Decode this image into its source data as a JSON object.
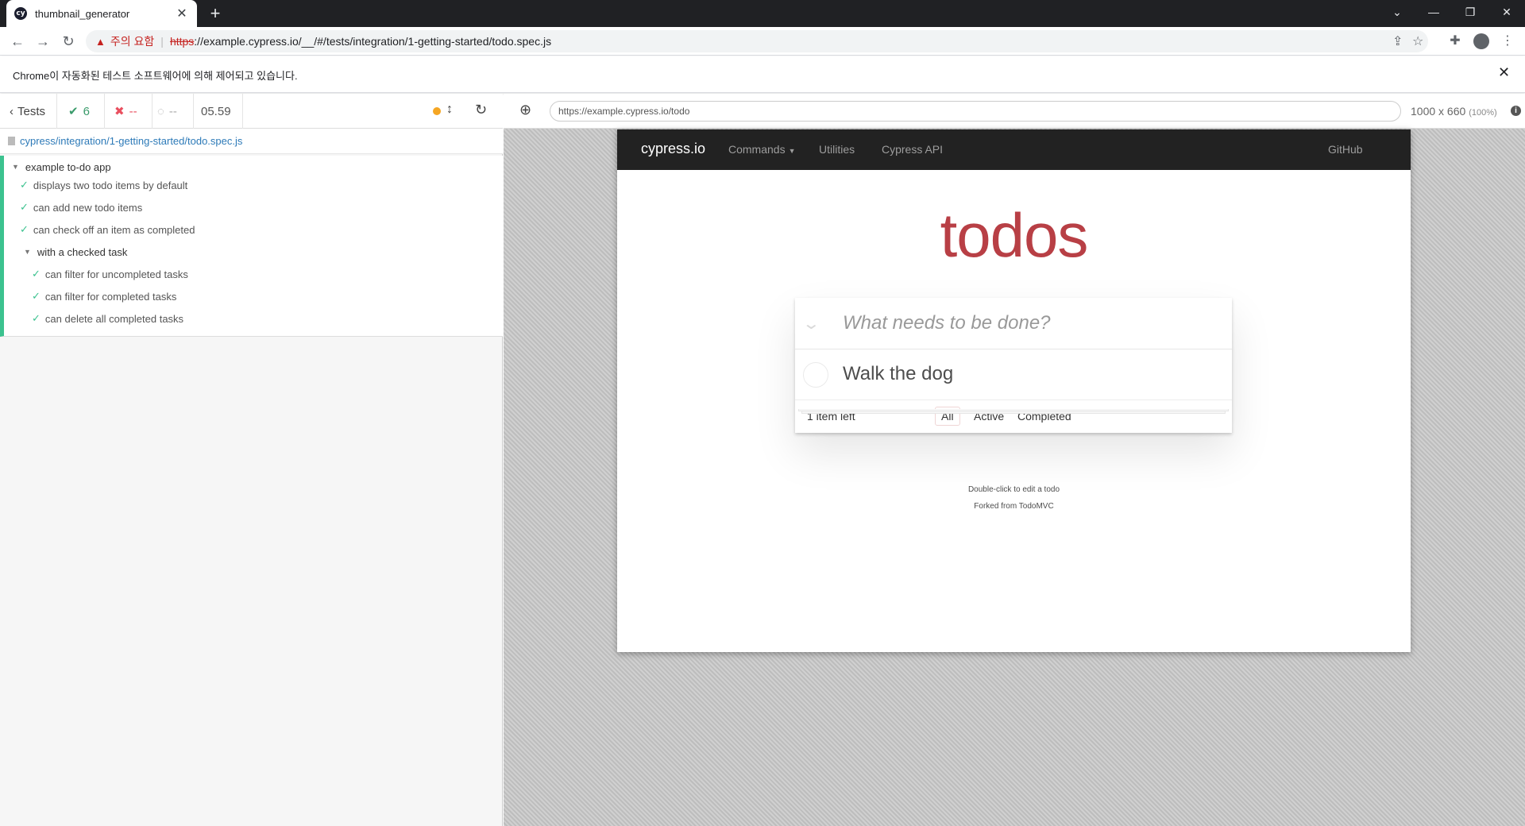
{
  "browser": {
    "tab_title": "thumbnail_generator",
    "tab_favicon": "cy",
    "new_tab": "+",
    "warning_label": "주의 요함",
    "url_scheme": "https",
    "url_rest": "://example.cypress.io/__/#/tests/integration/1-getting-started/todo.spec.js",
    "infobar_text": "Chrome이 자동화된 테스트 소프트웨어에 의해 제어되고 있습니다."
  },
  "reporter": {
    "tests_label": "Tests",
    "passed": "6",
    "failed": "--",
    "pending": "--",
    "duration": "05.59",
    "spec_path": "cypress/integration/1-getting-started/todo.spec.js",
    "suite": "example to-do app",
    "tests": [
      "displays two todo items by default",
      "can add new todo items",
      "can check off an item as completed"
    ],
    "nested_suite": "with a checked task",
    "nested_tests": [
      "can filter for uncompleted tasks",
      "can filter for completed tasks",
      "can delete all completed tasks"
    ]
  },
  "aut": {
    "url": "https://example.cypress.io/todo",
    "size": "1000 x 660",
    "scale": "(100%)"
  },
  "site": {
    "brand": "cypress.io",
    "nav": {
      "commands": "Commands",
      "utilities": "Utilities",
      "api": "Cypress API",
      "github": "GitHub"
    },
    "title": "todos",
    "placeholder": "What needs to be done?",
    "items": [
      "Walk the dog"
    ],
    "count": "1 item left",
    "filters": {
      "all": "All",
      "active": "Active",
      "completed": "Completed"
    },
    "info_line1": "Double-click to edit a todo",
    "info_line2": "Forked from TodoMVC"
  }
}
